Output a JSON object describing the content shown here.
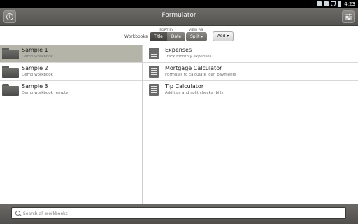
{
  "status": {
    "time": "4:23"
  },
  "header": {
    "title": "Formulator"
  },
  "toolbar": {
    "workbooks_label": "Workbooks",
    "sort_by_label": "SORT BY",
    "sort_options": [
      "Title",
      "Date"
    ],
    "sort_selected": "Title",
    "view_as_label": "VIEW AS",
    "view_value": "Split",
    "add_label": "Add"
  },
  "workbooks": [
    {
      "name": "Sample 1",
      "description": "Demo workbook",
      "selected": true
    },
    {
      "name": "Sample 2",
      "description": "Demo workbook",
      "selected": false
    },
    {
      "name": "Sample 3",
      "description": "Demo workbook (empty)",
      "selected": false
    }
  ],
  "calculators": [
    {
      "name": "Expenses",
      "description": "Track monthly expenses"
    },
    {
      "name": "Mortgage Calculator",
      "description": "Formulas to calculate loan payments"
    },
    {
      "name": "Tip Calculator",
      "description": "Add tips and split checks (bills)"
    }
  ],
  "search": {
    "placeholder": "Search all workbooks"
  }
}
